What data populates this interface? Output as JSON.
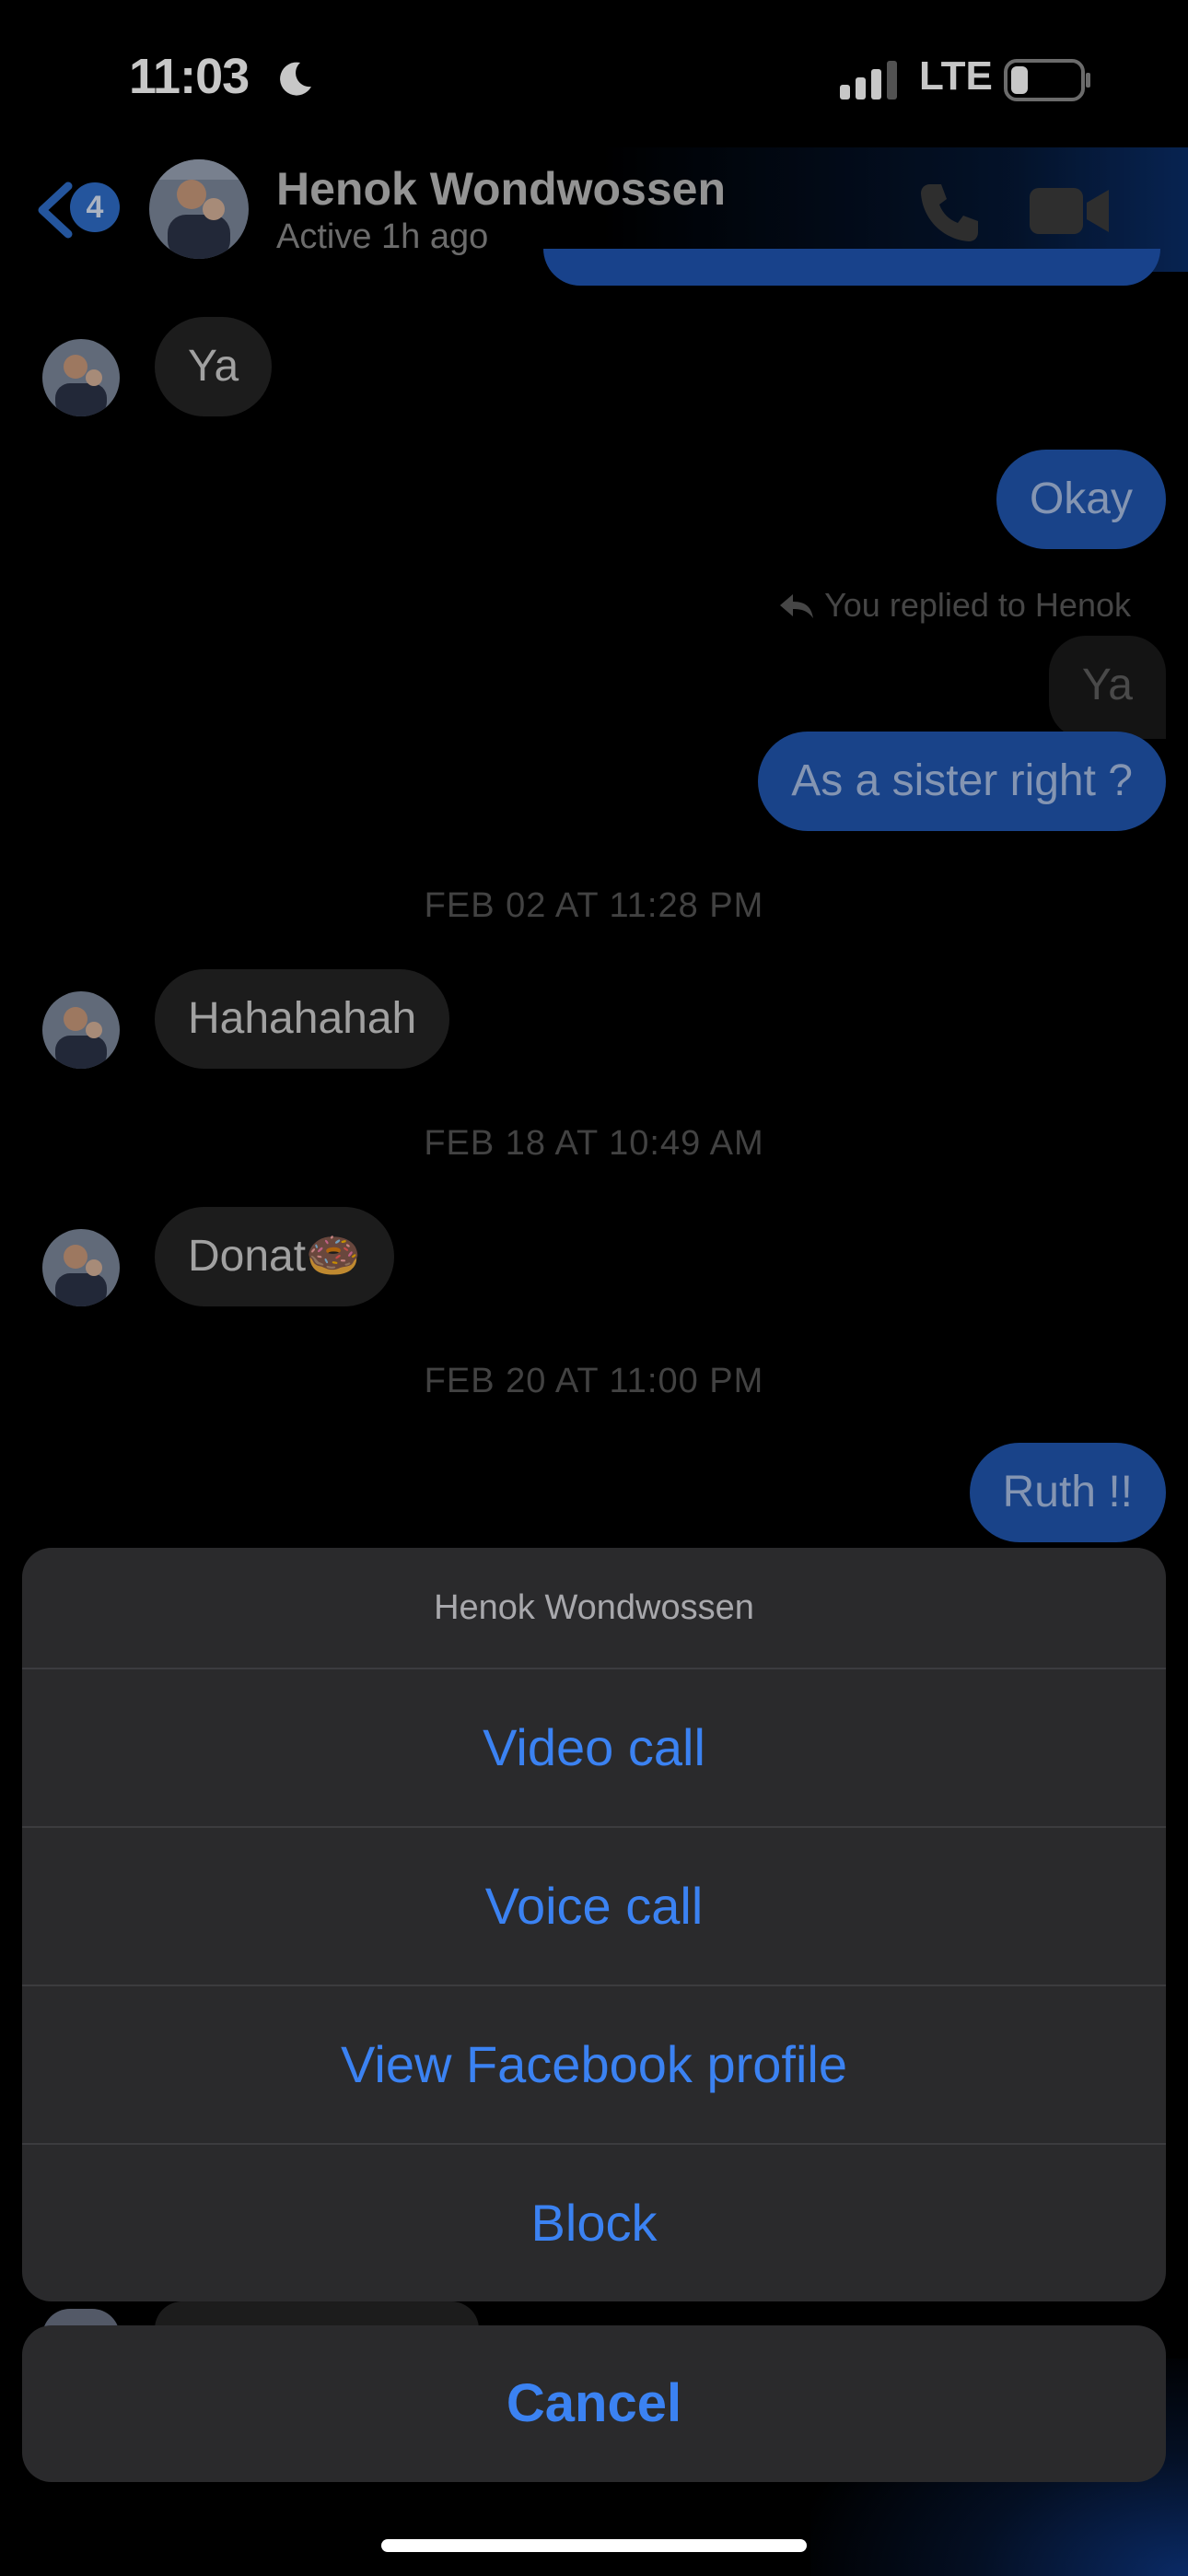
{
  "status_bar": {
    "time": "11:03",
    "network": "LTE"
  },
  "header": {
    "back_badge": "4",
    "contact_name": "Henok Wondwossen",
    "contact_status": "Active 1h ago"
  },
  "messages": [
    {
      "side": "in",
      "text": "Ya"
    },
    {
      "side": "out",
      "text": "Okay"
    },
    {
      "reply_label": "You replied to Henok",
      "quoted": "Ya"
    },
    {
      "side": "out",
      "text": "As a sister right ?"
    },
    {
      "date": "FEB 02 AT 11:28 PM"
    },
    {
      "side": "in",
      "text": "Hahahahah"
    },
    {
      "date": "FEB 18 AT 10:49 AM"
    },
    {
      "side": "in",
      "text": "Donat🍩"
    },
    {
      "date": "FEB 20 AT 11:00 PM"
    },
    {
      "side": "out",
      "text": "Ruth !!"
    }
  ],
  "action_sheet": {
    "title": "Henok Wondwossen",
    "items": [
      "Video call",
      "Voice call",
      "View Facebook profile",
      "Block"
    ],
    "cancel": "Cancel"
  },
  "colors": {
    "accent": "#3b82f2",
    "outgoing_bubble": "#2156b0",
    "incoming_bubble": "#252525",
    "sheet_bg": "#2a2a2c"
  }
}
